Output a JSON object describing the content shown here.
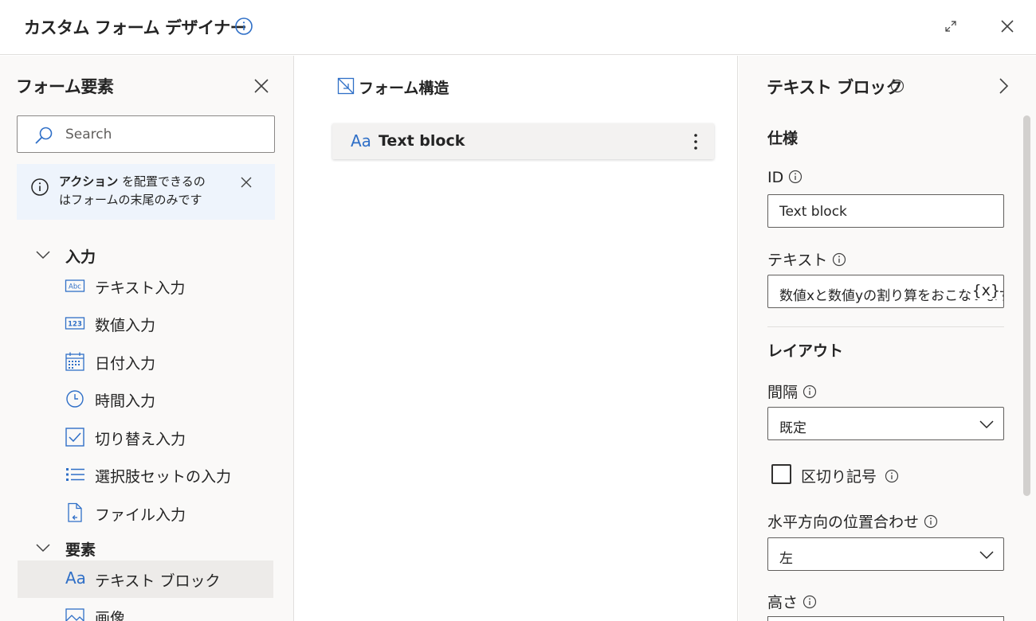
{
  "window": {
    "title": "カスタム フォーム デザイナー"
  },
  "left_panel": {
    "title": "フォーム要素",
    "search": {
      "placeholder": "Search",
      "value": ""
    },
    "notice": {
      "bold": "アクション",
      "line1_rest": " を配置できるの",
      "line2": "はフォームの末尾のみです"
    },
    "sections": [
      {
        "label": "入力",
        "items": [
          {
            "label": "テキスト入力",
            "icon": "text-input-icon"
          },
          {
            "label": "数値入力",
            "icon": "number-input-icon"
          },
          {
            "label": "日付入力",
            "icon": "calendar-icon"
          },
          {
            "label": "時間入力",
            "icon": "clock-icon"
          },
          {
            "label": "切り替え入力",
            "icon": "checkbox-icon"
          },
          {
            "label": "選択肢セットの入力",
            "icon": "list-icon"
          },
          {
            "label": "ファイル入力",
            "icon": "file-icon"
          }
        ]
      },
      {
        "label": "要素",
        "items": [
          {
            "label": "テキスト ブロック",
            "icon": "Aa",
            "selected": true
          },
          {
            "label": "画像",
            "icon": "image-icon"
          }
        ]
      }
    ]
  },
  "center_panel": {
    "title": "フォーム構造",
    "card": {
      "icon": "Aa",
      "label": "Text block"
    }
  },
  "right_panel": {
    "title": "テキスト ブロック",
    "spec_heading": "仕様",
    "id_label": "ID",
    "id_value": "Text block",
    "text_label": "テキスト",
    "text_value": "数値xと数値yの割り算をおこないます",
    "text_var": "{x}",
    "layout_heading": "レイアウト",
    "spacing_label": "間隔",
    "spacing_value": "既定",
    "separator_label": "区切り記号",
    "separator_checked": false,
    "halign_label": "水平方向の位置合わせ",
    "halign_value": "左",
    "height_label": "高さ"
  },
  "colors": {
    "accent": "#2f6fc7",
    "panel_bg": "#faf9f8",
    "selected_bg": "#edebe9",
    "notice_bg": "#eef4fc"
  }
}
